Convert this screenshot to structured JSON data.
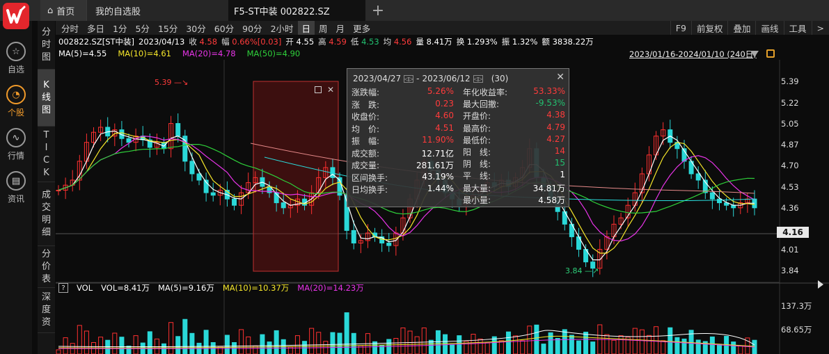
{
  "tabs": {
    "home": "首页",
    "favorites": "我的自选股",
    "stock": "F5-ST中装 002822.SZ"
  },
  "nav": [
    {
      "label": "自选",
      "icon": "star-icon",
      "active": false
    },
    {
      "label": "个股",
      "icon": "stock-chart-icon",
      "active": true
    },
    {
      "label": "行情",
      "icon": "market-trend-icon",
      "active": false
    },
    {
      "label": "资讯",
      "icon": "news-icon",
      "active": false
    }
  ],
  "side_tabs": [
    {
      "chars": [
        "分",
        "时",
        "图"
      ],
      "active": false
    },
    {
      "chars": [
        "K",
        "线",
        "图"
      ],
      "active": true
    },
    {
      "chars": [
        "T",
        "I",
        "C",
        "K"
      ],
      "active": false
    },
    {
      "chars": [
        "成",
        "交",
        "明",
        "细"
      ],
      "active": false
    },
    {
      "chars": [
        "分",
        "价",
        "表"
      ],
      "active": false
    },
    {
      "chars": [
        "深",
        "度",
        "资"
      ],
      "active": false
    }
  ],
  "periods": [
    {
      "label": "分时",
      "active": false
    },
    {
      "label": "多日",
      "active": false
    },
    {
      "label": "1分",
      "active": false
    },
    {
      "label": "5分",
      "active": false
    },
    {
      "label": "15分",
      "active": false
    },
    {
      "label": "30分",
      "active": false
    },
    {
      "label": "60分",
      "active": false
    },
    {
      "label": "90分",
      "active": false
    },
    {
      "label": "2小时",
      "active": false
    },
    {
      "label": "日",
      "active": true
    },
    {
      "label": "周",
      "active": false
    },
    {
      "label": "月",
      "active": false
    },
    {
      "label": "更多",
      "active": false
    }
  ],
  "tools": [
    "F9",
    "前复权",
    "叠加",
    "画线",
    "工具",
    ">"
  ],
  "quote": {
    "code": "002822.SZ[ST中装]",
    "date": "2023/04/13",
    "close_label": "收",
    "close": "4.58",
    "change_label": "幅",
    "change": "0.66%[0.03]",
    "open_label": "开",
    "open": "4.55",
    "high_label": "高",
    "high": "4.59",
    "low_label": "低",
    "low": "4.53",
    "avg_label": "均",
    "avg": "4.56",
    "volume": "量 8.41万",
    "turnover": "换 1.293%",
    "amplitude": "振 1.32%",
    "amount": "额 3838.22万"
  },
  "ma": [
    {
      "text": "MA(5)=4.55",
      "color": "#ffffff"
    },
    {
      "text": "MA(10)=4.61",
      "color": "#f5e62a"
    },
    {
      "text": "MA(20)=4.78",
      "color": "#e834e8"
    },
    {
      "text": "MA(50)=4.90",
      "color": "#2ed03a"
    }
  ],
  "date_range": "2023/01/16-2024/01/10 (240日)",
  "y_axis": [
    "5.39",
    "5.22",
    "5.05",
    "4.87",
    "4.70",
    "4.53",
    "4.36",
    "4.16",
    "4.01",
    "3.84"
  ],
  "current_price": "4.16",
  "annotations": {
    "max": "5.39",
    "min": "3.84"
  },
  "vol": {
    "title": "VOL",
    "vol": "VOL=8.41万",
    "ma5": "MA(5)=9.16万",
    "ma10": "MA(10)=10.37万",
    "ma20": "MA(20)=14.23万",
    "help": "?",
    "y_axis": [
      "137.3万",
      "68.65万"
    ]
  },
  "popup": {
    "start": "2023/04/27",
    "end": "2023/06/12",
    "days": "(30)",
    "left": [
      {
        "k": "涨跌幅:",
        "v": "5.26%",
        "c": "up"
      },
      {
        "k": "涨　跌:",
        "v": "0.23",
        "c": "up"
      },
      {
        "k": "收盘价:",
        "v": "4.60",
        "c": "up"
      },
      {
        "k": "均　价:",
        "v": "4.51",
        "c": "up"
      },
      {
        "k": "振　幅:",
        "v": "11.90%",
        "c": "up"
      },
      {
        "k": "成交额:",
        "v": "12.71亿",
        "c": "w"
      },
      {
        "k": "成交量:",
        "v": "281.61万",
        "c": "w"
      },
      {
        "k": "区间换手:",
        "v": "43.19%",
        "c": "w"
      },
      {
        "k": "日均换手:",
        "v": "1.44%",
        "c": "w"
      }
    ],
    "right": [
      {
        "k": "年化收益率:",
        "v": "53.33%",
        "c": "up"
      },
      {
        "k": "最大回撤:",
        "v": "-9.53%",
        "c": "dn"
      },
      {
        "k": "开盘价:",
        "v": "4.38",
        "c": "up"
      },
      {
        "k": "最高价:",
        "v": "4.79",
        "c": "up"
      },
      {
        "k": "最低价:",
        "v": "4.27",
        "c": "up"
      },
      {
        "k": "阳　线:",
        "v": "14",
        "c": "up"
      },
      {
        "k": "阴　线:",
        "v": "15",
        "c": "dn"
      },
      {
        "k": "平　线:",
        "v": "1",
        "c": "w"
      },
      {
        "k": "最大量:",
        "v": "34.81万",
        "c": "w"
      },
      {
        "k": "最小量:",
        "v": "4.58万",
        "c": "w"
      }
    ]
  },
  "colors": {
    "up": "#ff3b3b",
    "down": "#22c070",
    "cyan": "#2ae0e0",
    "ma5": "#ffffff",
    "ma10": "#f5e62a",
    "ma20": "#e834e8",
    "ma50": "#2ed03a"
  }
}
